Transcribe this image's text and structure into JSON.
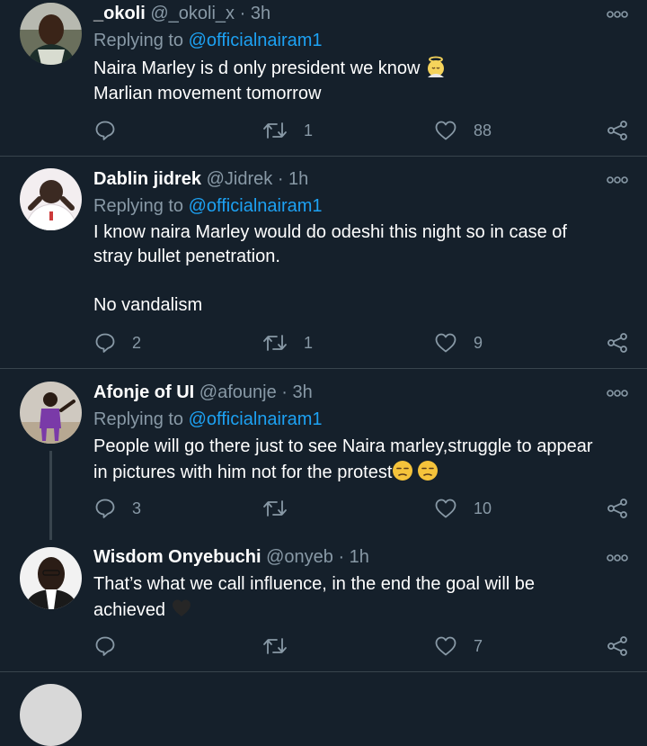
{
  "tweets": [
    {
      "name": "_okoli",
      "handle": "@_okoli_x",
      "sep": "·",
      "time": "3h",
      "replying_label": "Replying to",
      "mention": "@officialnairam1",
      "lines": [
        "Naira Marley is d only president we know",
        "Marlian movement tomorrow"
      ],
      "reply_count": "",
      "retweet_count": "1",
      "like_count": "88"
    },
    {
      "name": "Dablin jidrek",
      "handle": "@Jidrek",
      "sep": "·",
      "time": "1h",
      "replying_label": "Replying to",
      "mention": "@officialnairam1",
      "lines": [
        "I know naira Marley would do odeshi this night so in case of",
        "stray bullet penetration.",
        "",
        "No vandalism"
      ],
      "reply_count": "2",
      "retweet_count": "1",
      "like_count": "9"
    },
    {
      "name": "Afonje of UI",
      "handle": "@afounje",
      "sep": "·",
      "time": "3h",
      "replying_label": "Replying to",
      "mention": "@officialnairam1",
      "lines": [
        "People will go there just to see Naira marley,struggle to appear",
        "in pictures with him not for the protest"
      ],
      "reply_count": "3",
      "retweet_count": "",
      "like_count": "10"
    },
    {
      "name": "Wisdom Onyebuchi",
      "handle": "@onyeb",
      "sep": "·",
      "time": "1h",
      "lines": [
        "That’s what we call influence, in the end the goal will be",
        "achieved"
      ],
      "reply_count": "",
      "retweet_count": "",
      "like_count": "7"
    }
  ],
  "icons": {
    "reply": "reply-icon",
    "retweet": "retweet-icon",
    "like": "like-icon",
    "share": "share-icon",
    "more": "more-icon"
  },
  "colors": {
    "background": "#15202b",
    "secondary_text": "#8899a6",
    "mention": "#1da1f2",
    "divider": "#38444d"
  }
}
